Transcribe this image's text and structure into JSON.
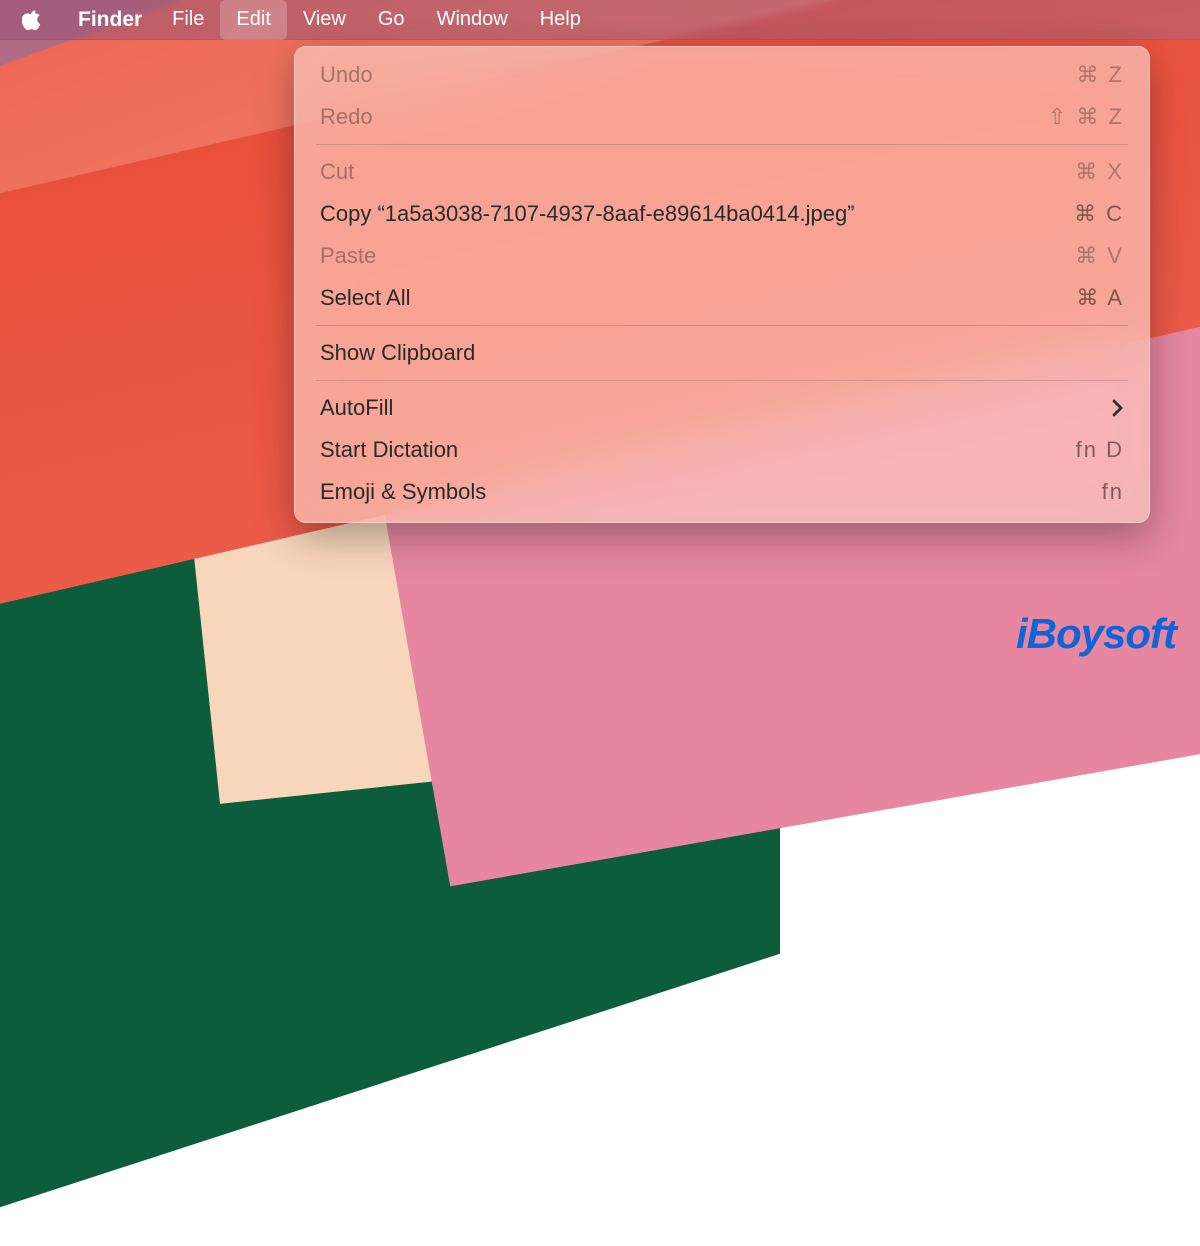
{
  "menubar": {
    "app_name": "Finder",
    "items": [
      {
        "label": "File",
        "active": false
      },
      {
        "label": "Edit",
        "active": true
      },
      {
        "label": "View",
        "active": false
      },
      {
        "label": "Go",
        "active": false
      },
      {
        "label": "Window",
        "active": false
      },
      {
        "label": "Help",
        "active": false
      }
    ]
  },
  "edit_menu": {
    "undo": {
      "label": "Undo",
      "shortcut": "⌘ Z",
      "enabled": false
    },
    "redo": {
      "label": "Redo",
      "shortcut": "⇧ ⌘ Z",
      "enabled": false
    },
    "cut": {
      "label": "Cut",
      "shortcut": "⌘ X",
      "enabled": false
    },
    "copy": {
      "label": "Copy “1a5a3038-7107-4937-8aaf-e89614ba0414.jpeg”",
      "shortcut": "⌘ C",
      "enabled": true
    },
    "paste": {
      "label": "Paste",
      "shortcut": "⌘ V",
      "enabled": false
    },
    "select_all": {
      "label": "Select All",
      "shortcut": "⌘ A",
      "enabled": true
    },
    "show_clip": {
      "label": "Show Clipboard",
      "shortcut": "",
      "enabled": true
    },
    "autofill": {
      "label": "AutoFill",
      "shortcut": "",
      "enabled": true,
      "submenu": true
    },
    "dictation": {
      "label": "Start Dictation",
      "shortcut": "fn D",
      "enabled": true
    },
    "emoji": {
      "label": "Emoji & Symbols",
      "shortcut": "fn",
      "enabled": true
    }
  },
  "watermark": {
    "text": "iBoysoft"
  }
}
